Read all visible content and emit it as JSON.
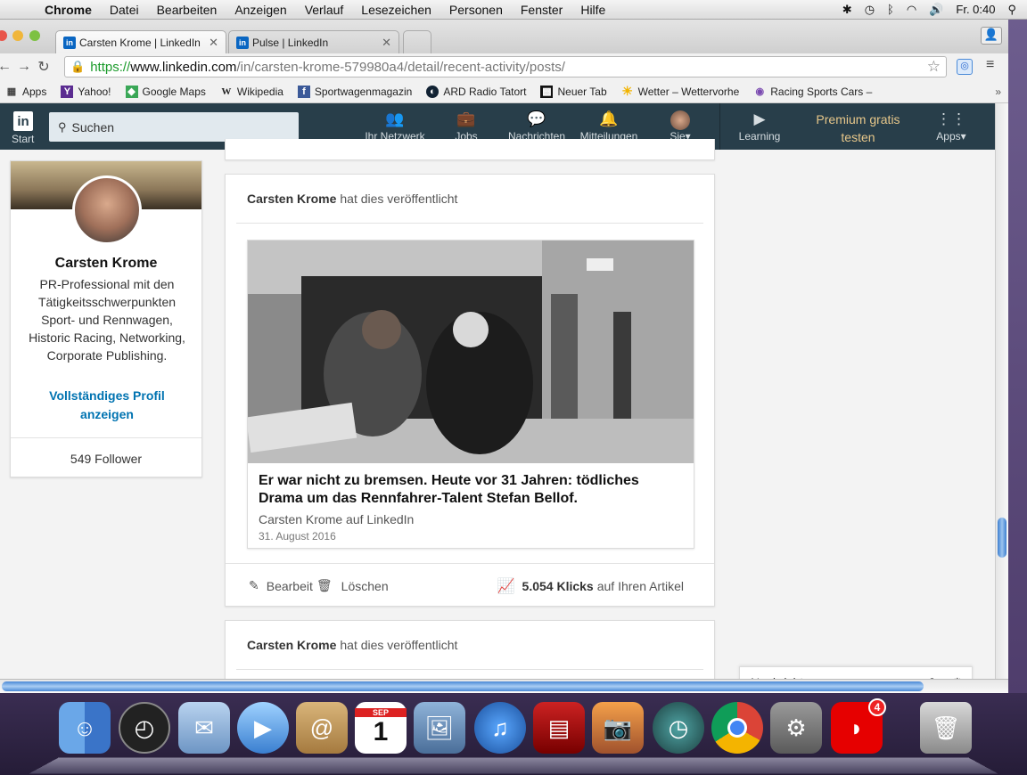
{
  "menubar": {
    "app": "Chrome",
    "items": [
      "Datei",
      "Bearbeiten",
      "Anzeigen",
      "Verlauf",
      "Lesezeichen",
      "Personen",
      "Fenster",
      "Hilfe"
    ],
    "clock": "Fr. 0:40"
  },
  "tabs": [
    {
      "title": "Carsten Krome | LinkedIn",
      "icon": "linkedin-icon"
    },
    {
      "title": "Pulse | LinkedIn",
      "icon": "linkedin-icon"
    }
  ],
  "address": {
    "scheme": "https://",
    "host": "www.linkedin.com",
    "path": "/in/carsten-krome-579980a4/detail/recent-activity/posts/"
  },
  "bookmarks": [
    {
      "label": "Apps",
      "icon": "apps-grid-icon"
    },
    {
      "label": "Yahoo!",
      "icon": "yahoo-icon"
    },
    {
      "label": "Google Maps",
      "icon": "maps-icon"
    },
    {
      "label": "Wikipedia",
      "icon": "wikipedia-icon"
    },
    {
      "label": "Sportwagenmagazin",
      "icon": "facebook-icon"
    },
    {
      "label": "ARD Radio Tatort",
      "icon": "ard-icon"
    },
    {
      "label": "Neuer Tab",
      "icon": "newtab-icon"
    },
    {
      "label": "Wetter – Wettervorhe",
      "icon": "sun-icon"
    },
    {
      "label": "Racing Sports Cars –",
      "icon": "racing-icon"
    }
  ],
  "linav": {
    "start": "Start",
    "search_placeholder": "Suchen",
    "network": "Ihr Netzwerk",
    "jobs": "Jobs",
    "messages": "Nachrichten",
    "notifications": "Mitteilungen",
    "me": "Sie",
    "learning": "Learning",
    "premium": "Premium gratis testen",
    "apps": "Apps"
  },
  "profile": {
    "name": "Carsten Krome",
    "headline": "PR-Professional mit den Tätigkeitsschwerpunkten Sport- und Rennwagen, Historic Racing, Networking, Corporate Publishing.",
    "link": "Vollständiges Profil anzeigen",
    "followers": "549 Follower"
  },
  "post1": {
    "author": "Carsten Krome",
    "action": "hat dies veröffentlicht",
    "article_title": "Er war nicht zu bremsen. Heute vor 31 Jahren: tödliches Drama um das Rennfahrer-Talent Stefan Bellof.",
    "article_source": "Carsten Krome auf LinkedIn",
    "article_date": "31. August 2016",
    "edit": "Bearbeit",
    "delete": "Löschen",
    "clicks": "5.054 Klicks",
    "clicks_suffix": "auf Ihren Artikel"
  },
  "post2": {
    "author": "Carsten Krome",
    "action": "hat dies veröffentlicht"
  },
  "messaging": {
    "title": "Nachrichten"
  },
  "dock": {
    "calendar_month": "SEP",
    "calendar_day": "1",
    "vodafone_badge": "4"
  }
}
